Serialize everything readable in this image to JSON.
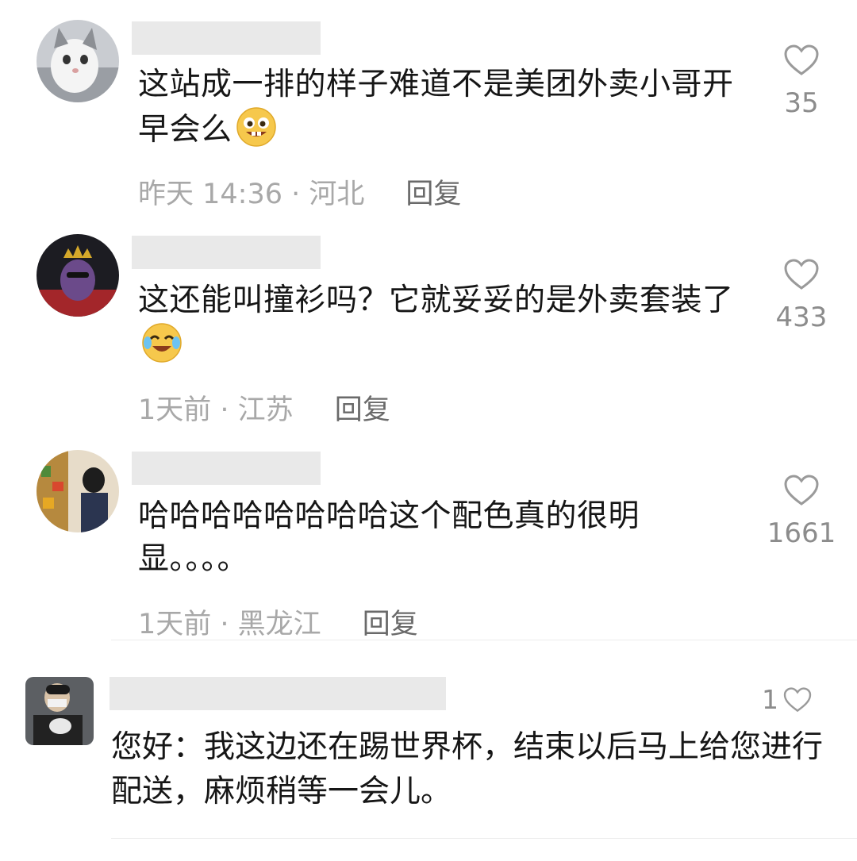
{
  "comments": [
    {
      "text": "这站成一排的样子难道不是美团外卖小哥开早会么",
      "emoji": "grin-emoji",
      "time": "昨天 14:36",
      "location": "河北",
      "reply_label": "回复",
      "likes": "35"
    },
    {
      "text": "这还能叫撞衫吗？它就妥妥的是外卖套装了",
      "emoji": "laugh-cry-emoji",
      "time": "1天前",
      "location": "江苏",
      "reply_label": "回复",
      "likes": "433"
    },
    {
      "text": "哈哈哈哈哈哈哈哈这个配色真的很明显。。。。",
      "time": "1天前",
      "location": "黑龙江",
      "reply_label": "回复",
      "likes": "1661"
    },
    {
      "text": "您好：我这边还在踢世界杯，结束以后马上给您进行配送，麻烦稍等一会儿。",
      "likes": "1"
    }
  ],
  "separator": " · ",
  "colors": {
    "like_icon": "#9a9a9a",
    "meta_text": "#a8a8a8",
    "redacted_name": "#e9e9e9"
  }
}
